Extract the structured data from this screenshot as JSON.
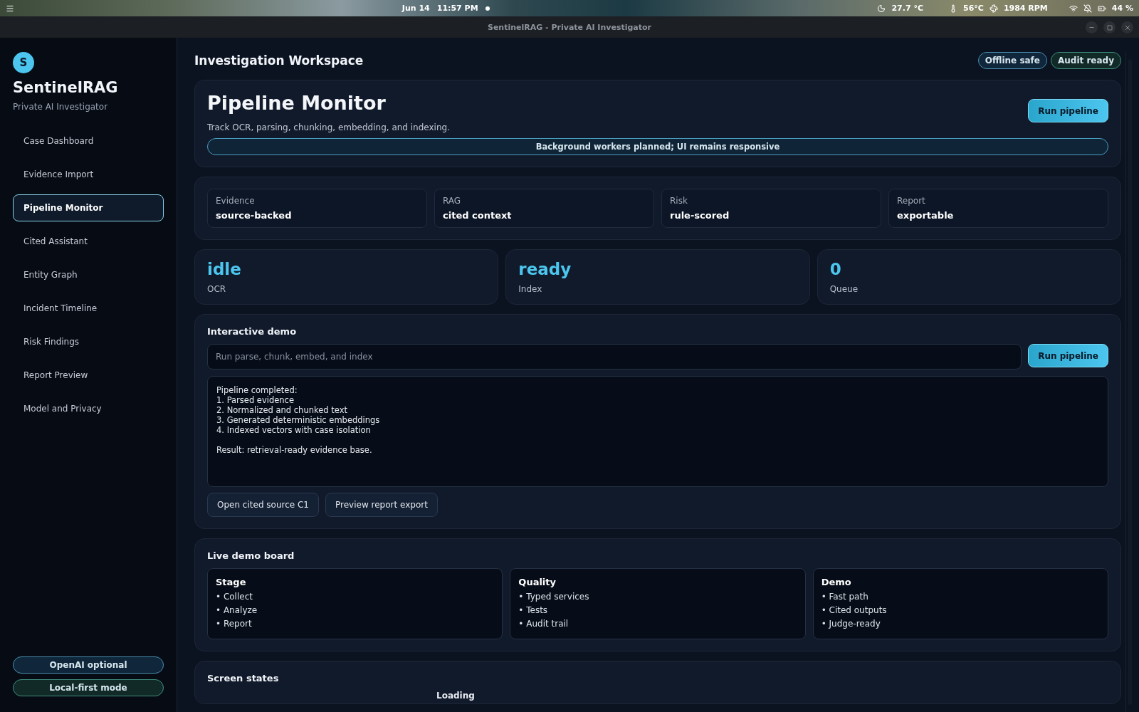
{
  "system_bar": {
    "date": "Jun 14",
    "time": "11:57 PM",
    "temperature": "27.7 °C",
    "cpu_temp": "56°C",
    "fan": "1984 RPM",
    "battery": "44 %"
  },
  "window": {
    "title": "SentinelRAG - Private AI Investigator"
  },
  "sidebar": {
    "logo_letter": "S",
    "app_name": "SentinelRAG",
    "subtitle": "Private AI Investigator",
    "items": [
      {
        "label": "Case Dashboard",
        "selected": false
      },
      {
        "label": "Evidence Import",
        "selected": false
      },
      {
        "label": "Pipeline Monitor",
        "selected": true
      },
      {
        "label": "Cited Assistant",
        "selected": false
      },
      {
        "label": "Entity Graph",
        "selected": false
      },
      {
        "label": "Incident Timeline",
        "selected": false
      },
      {
        "label": "Risk Findings",
        "selected": false
      },
      {
        "label": "Report Preview",
        "selected": false
      },
      {
        "label": "Model and Privacy",
        "selected": false
      }
    ],
    "badges": [
      {
        "label": "OpenAI optional",
        "kind": "info"
      },
      {
        "label": "Local-first mode",
        "kind": "success"
      }
    ]
  },
  "header": {
    "title": "Investigation Workspace",
    "badges": [
      {
        "label": "Offline safe",
        "kind": "info"
      },
      {
        "label": "Audit ready",
        "kind": "success"
      }
    ]
  },
  "hero": {
    "title": "Pipeline Monitor",
    "description": "Track OCR, parsing, chunking, embedding, and indexing.",
    "button": "Run pipeline",
    "banner": "Background workers planned; UI remains responsive"
  },
  "summary": [
    {
      "label": "Evidence",
      "value": "source-backed"
    },
    {
      "label": "RAG",
      "value": "cited context"
    },
    {
      "label": "Risk",
      "value": "rule-scored"
    },
    {
      "label": "Report",
      "value": "exportable"
    }
  ],
  "stats": [
    {
      "value": "idle",
      "label": "OCR"
    },
    {
      "value": "ready",
      "label": "Index"
    },
    {
      "value": "0",
      "label": "Queue"
    }
  ],
  "demo": {
    "title": "Interactive demo",
    "placeholder": "Run parse, chunk, embed, and index",
    "button": "Run pipeline",
    "output": [
      [
        "Pipeline completed:",
        "1. Parsed evidence",
        "2. Normalized and chunked text",
        "3. Generated deterministic embeddings",
        "4. Indexed vectors with case isolation"
      ],
      [
        "Result: retrieval-ready evidence base."
      ]
    ],
    "actions": [
      "Open cited source C1",
      "Preview report export"
    ]
  },
  "board": {
    "title": "Live demo board",
    "columns": [
      {
        "title": "Stage",
        "items": [
          "• Collect",
          "• Analyze",
          "• Report"
        ]
      },
      {
        "title": "Quality",
        "items": [
          "• Typed services",
          "• Tests",
          "• Audit trail"
        ]
      },
      {
        "title": "Demo",
        "items": [
          "• Fast path",
          "• Cited outputs",
          "• Judge-ready"
        ]
      }
    ]
  },
  "screen_states": {
    "title": "Screen states",
    "items": [
      "Loading"
    ]
  }
}
